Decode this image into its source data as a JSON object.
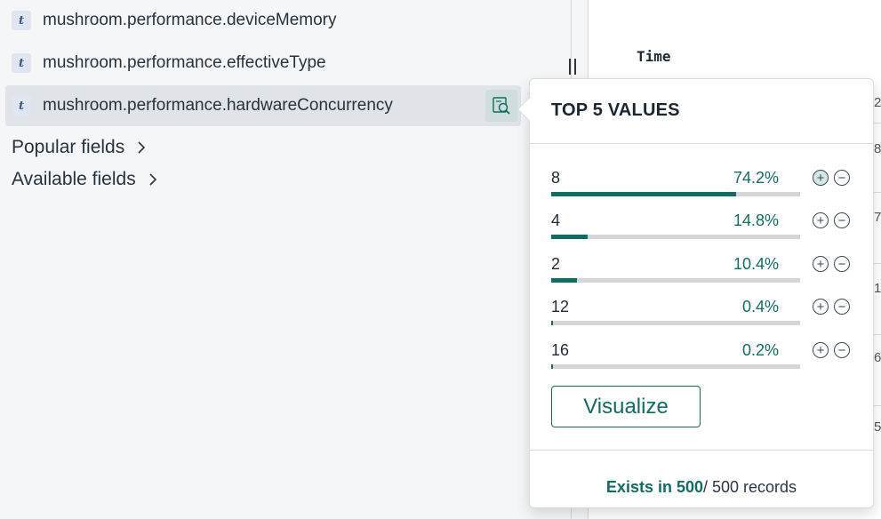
{
  "sidebar": {
    "fields": [
      {
        "type_badge": "t",
        "name": "mushroom.performance.deviceMemory"
      },
      {
        "type_badge": "t",
        "name": "mushroom.performance.effectiveType"
      },
      {
        "type_badge": "t",
        "name": "mushroom.performance.hardwareConcurrency"
      }
    ],
    "sections": [
      {
        "label": "Popular fields"
      },
      {
        "label": "Available fields"
      }
    ]
  },
  "doc_table": {
    "time_header": "Time",
    "row_edge_glyphs": [
      "2",
      "8",
      "7",
      "1",
      "6",
      "5"
    ]
  },
  "popover": {
    "title": "TOP 5 VALUES",
    "values": [
      {
        "label": "8",
        "pct": "74.2%",
        "fraction": 0.742
      },
      {
        "label": "4",
        "pct": "14.8%",
        "fraction": 0.148
      },
      {
        "label": "2",
        "pct": "10.4%",
        "fraction": 0.104
      },
      {
        "label": "12",
        "pct": "0.4%",
        "fraction": 0.004
      },
      {
        "label": "16",
        "pct": "0.2%",
        "fraction": 0.002
      }
    ],
    "visualize_label": "Visualize",
    "footer": {
      "exists_text": "Exists in 500",
      "rest_text": " / 500 records"
    }
  },
  "colors": {
    "accent": "#0e6e62",
    "bar_track": "#d3d6da",
    "sidebar_bg": "#f5f6f8",
    "active_row_bg": "#e0e3e7"
  },
  "icons": {
    "type_badge": "text-type-icon",
    "details": "inspect-magnifier-icon",
    "chevron": "chevron-right-icon",
    "filter_for": "plus-circle-icon",
    "filter_out": "minus-circle-icon",
    "drag_handle": "resize-handle-icon"
  }
}
